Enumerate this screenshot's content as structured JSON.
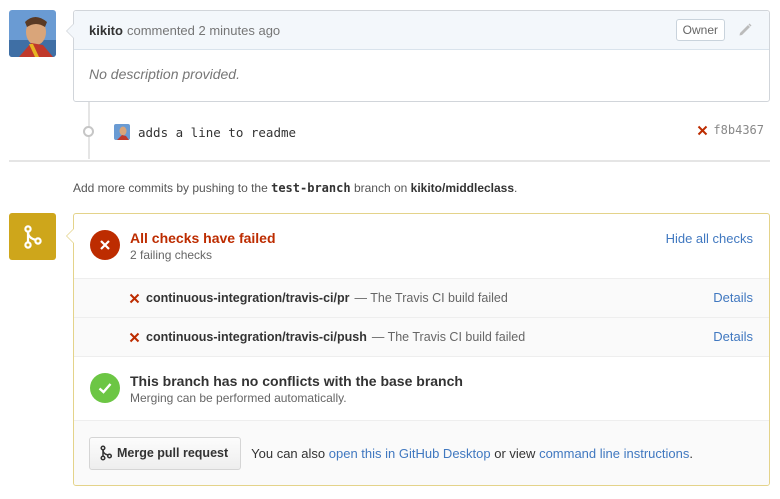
{
  "comment": {
    "author": "kikito",
    "meta": "commented 2 minutes ago",
    "badge": "Owner",
    "body": "No description provided."
  },
  "commit": {
    "message": "adds a line to readme",
    "sha": "f8b4367"
  },
  "push_hint": {
    "prefix": "Add more commits by pushing to the",
    "branch": "test-branch",
    "middle": "branch on",
    "repo": "kikito/middleclass",
    "suffix": "."
  },
  "checks": {
    "title": "All checks have failed",
    "subtitle": "2 failing checks",
    "hide_label": "Hide all checks",
    "items": [
      {
        "name": "continuous-integration/travis-ci/pr",
        "desc": "— The Travis CI build failed",
        "details": "Details"
      },
      {
        "name": "continuous-integration/travis-ci/push",
        "desc": "— The Travis CI build failed",
        "details": "Details"
      }
    ]
  },
  "conflicts": {
    "title": "This branch has no conflicts with the base branch",
    "subtitle": "Merging can be performed automatically."
  },
  "merge": {
    "button_label": "Merge pull request",
    "alt_prefix": "You can also",
    "alt_link1": "open this in GitHub Desktop",
    "alt_middle": "or view",
    "alt_link2": "command line instructions",
    "alt_suffix": "."
  },
  "colors": {
    "fail": "#bd2c00",
    "success": "#6cc644",
    "merge_icon_bg": "#cea61b",
    "link": "#4078c0"
  }
}
